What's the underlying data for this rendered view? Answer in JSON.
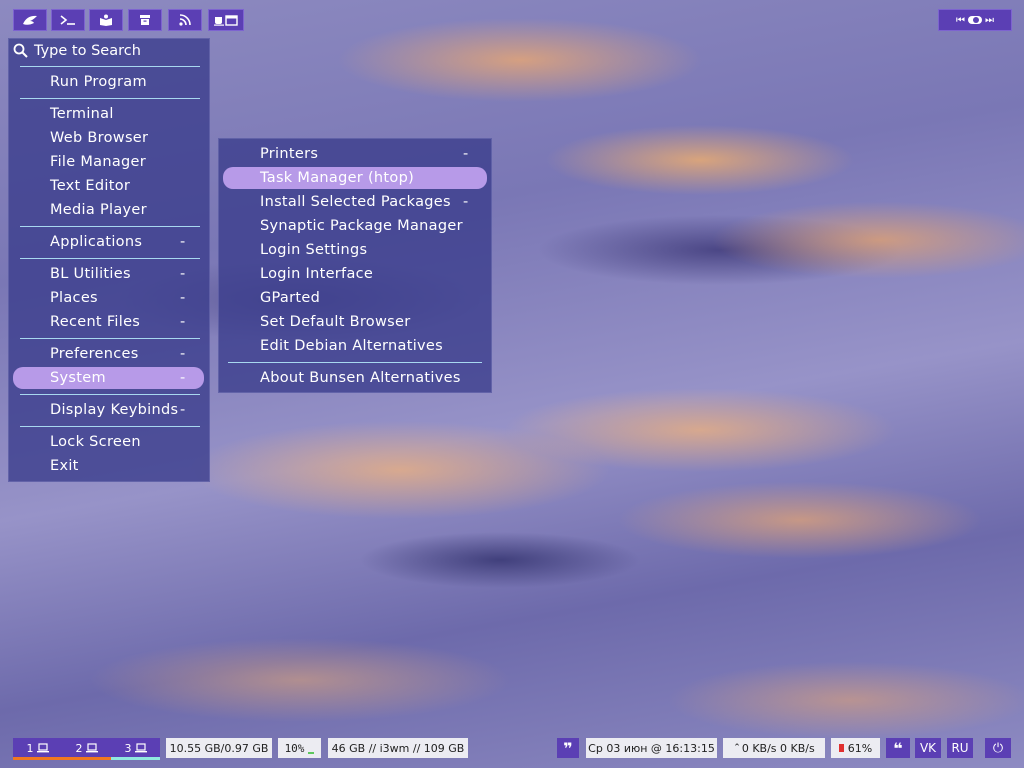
{
  "top_launchers": [
    {
      "name": "app-launcher-icon"
    },
    {
      "name": "terminal-icon"
    },
    {
      "name": "book-icon"
    },
    {
      "name": "archive-icon"
    },
    {
      "name": "rss-icon"
    },
    {
      "name": "coffee-window-icon"
    }
  ],
  "media_controls": {
    "prev": "⏮",
    "toggle": "⬤",
    "next": "⏭"
  },
  "root_menu": {
    "search_placeholder": "Type to Search",
    "run_program": "Run Program",
    "terminal": "Terminal",
    "web_browser": "Web Browser",
    "file_manager": "File Manager",
    "text_editor": "Text Editor",
    "media_player": "Media Player",
    "applications": "Applications",
    "bl_utilities": "BL Utilities",
    "places": "Places",
    "recent_files": "Recent Files",
    "preferences": "Preferences",
    "system": "System",
    "display_keybinds": "Display Keybinds",
    "lock_screen": "Lock Screen",
    "exit": "Exit",
    "submenu_marker": "-"
  },
  "system_menu": {
    "printers": "Printers",
    "task_manager": "Task Manager (htop)",
    "install_selected": "Install Selected Packages",
    "synaptic": "Synaptic Package Manager",
    "login_settings": "Login Settings",
    "login_interface": "Login Interface",
    "gparted": "GParted",
    "default_browser": "Set Default Browser",
    "debian_alternatives": "Edit Debian Alternatives",
    "about": "About Bunsen Alternatives",
    "submenu_marker": "-"
  },
  "bottom_bar": {
    "workspaces": [
      "1",
      "2",
      "3"
    ],
    "memory": "10.55 GB/0.97 GB",
    "cpu": "10%",
    "disk": "46 GB // i3wm // 109 GB",
    "quote_left": "❞",
    "datetime": "Ср 03 июн @ 16:13:15",
    "network": "0 KB/s  0 KB/s",
    "battery": "61%",
    "quote_right": "❝",
    "lang_vk": "VK",
    "lang_ru": "RU",
    "power_icon": "⏻"
  },
  "colors": {
    "accent": "#5b3fb4",
    "highlight": "#b79ae8",
    "separator": "#a8d8f0",
    "ws1_underline": "#f07820",
    "ws3_underline": "#90e8e0"
  }
}
